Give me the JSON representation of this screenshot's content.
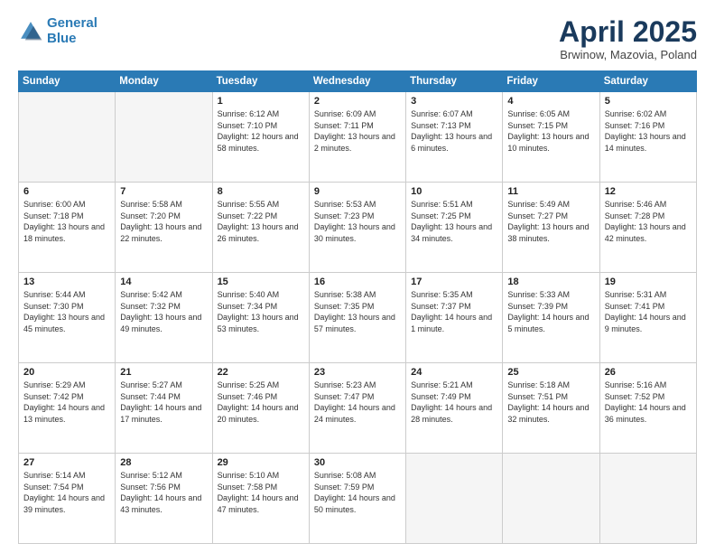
{
  "logo": {
    "line1": "General",
    "line2": "Blue"
  },
  "title": "April 2025",
  "subtitle": "Brwinow, Mazovia, Poland",
  "weekdays": [
    "Sunday",
    "Monday",
    "Tuesday",
    "Wednesday",
    "Thursday",
    "Friday",
    "Saturday"
  ],
  "weeks": [
    [
      {
        "day": "",
        "empty": true
      },
      {
        "day": "",
        "empty": true
      },
      {
        "day": "1",
        "sunrise": "Sunrise: 6:12 AM",
        "sunset": "Sunset: 7:10 PM",
        "daylight": "Daylight: 12 hours and 58 minutes."
      },
      {
        "day": "2",
        "sunrise": "Sunrise: 6:09 AM",
        "sunset": "Sunset: 7:11 PM",
        "daylight": "Daylight: 13 hours and 2 minutes."
      },
      {
        "day": "3",
        "sunrise": "Sunrise: 6:07 AM",
        "sunset": "Sunset: 7:13 PM",
        "daylight": "Daylight: 13 hours and 6 minutes."
      },
      {
        "day": "4",
        "sunrise": "Sunrise: 6:05 AM",
        "sunset": "Sunset: 7:15 PM",
        "daylight": "Daylight: 13 hours and 10 minutes."
      },
      {
        "day": "5",
        "sunrise": "Sunrise: 6:02 AM",
        "sunset": "Sunset: 7:16 PM",
        "daylight": "Daylight: 13 hours and 14 minutes."
      }
    ],
    [
      {
        "day": "6",
        "sunrise": "Sunrise: 6:00 AM",
        "sunset": "Sunset: 7:18 PM",
        "daylight": "Daylight: 13 hours and 18 minutes."
      },
      {
        "day": "7",
        "sunrise": "Sunrise: 5:58 AM",
        "sunset": "Sunset: 7:20 PM",
        "daylight": "Daylight: 13 hours and 22 minutes."
      },
      {
        "day": "8",
        "sunrise": "Sunrise: 5:55 AM",
        "sunset": "Sunset: 7:22 PM",
        "daylight": "Daylight: 13 hours and 26 minutes."
      },
      {
        "day": "9",
        "sunrise": "Sunrise: 5:53 AM",
        "sunset": "Sunset: 7:23 PM",
        "daylight": "Daylight: 13 hours and 30 minutes."
      },
      {
        "day": "10",
        "sunrise": "Sunrise: 5:51 AM",
        "sunset": "Sunset: 7:25 PM",
        "daylight": "Daylight: 13 hours and 34 minutes."
      },
      {
        "day": "11",
        "sunrise": "Sunrise: 5:49 AM",
        "sunset": "Sunset: 7:27 PM",
        "daylight": "Daylight: 13 hours and 38 minutes."
      },
      {
        "day": "12",
        "sunrise": "Sunrise: 5:46 AM",
        "sunset": "Sunset: 7:28 PM",
        "daylight": "Daylight: 13 hours and 42 minutes."
      }
    ],
    [
      {
        "day": "13",
        "sunrise": "Sunrise: 5:44 AM",
        "sunset": "Sunset: 7:30 PM",
        "daylight": "Daylight: 13 hours and 45 minutes."
      },
      {
        "day": "14",
        "sunrise": "Sunrise: 5:42 AM",
        "sunset": "Sunset: 7:32 PM",
        "daylight": "Daylight: 13 hours and 49 minutes."
      },
      {
        "day": "15",
        "sunrise": "Sunrise: 5:40 AM",
        "sunset": "Sunset: 7:34 PM",
        "daylight": "Daylight: 13 hours and 53 minutes."
      },
      {
        "day": "16",
        "sunrise": "Sunrise: 5:38 AM",
        "sunset": "Sunset: 7:35 PM",
        "daylight": "Daylight: 13 hours and 57 minutes."
      },
      {
        "day": "17",
        "sunrise": "Sunrise: 5:35 AM",
        "sunset": "Sunset: 7:37 PM",
        "daylight": "Daylight: 14 hours and 1 minute."
      },
      {
        "day": "18",
        "sunrise": "Sunrise: 5:33 AM",
        "sunset": "Sunset: 7:39 PM",
        "daylight": "Daylight: 14 hours and 5 minutes."
      },
      {
        "day": "19",
        "sunrise": "Sunrise: 5:31 AM",
        "sunset": "Sunset: 7:41 PM",
        "daylight": "Daylight: 14 hours and 9 minutes."
      }
    ],
    [
      {
        "day": "20",
        "sunrise": "Sunrise: 5:29 AM",
        "sunset": "Sunset: 7:42 PM",
        "daylight": "Daylight: 14 hours and 13 minutes."
      },
      {
        "day": "21",
        "sunrise": "Sunrise: 5:27 AM",
        "sunset": "Sunset: 7:44 PM",
        "daylight": "Daylight: 14 hours and 17 minutes."
      },
      {
        "day": "22",
        "sunrise": "Sunrise: 5:25 AM",
        "sunset": "Sunset: 7:46 PM",
        "daylight": "Daylight: 14 hours and 20 minutes."
      },
      {
        "day": "23",
        "sunrise": "Sunrise: 5:23 AM",
        "sunset": "Sunset: 7:47 PM",
        "daylight": "Daylight: 14 hours and 24 minutes."
      },
      {
        "day": "24",
        "sunrise": "Sunrise: 5:21 AM",
        "sunset": "Sunset: 7:49 PM",
        "daylight": "Daylight: 14 hours and 28 minutes."
      },
      {
        "day": "25",
        "sunrise": "Sunrise: 5:18 AM",
        "sunset": "Sunset: 7:51 PM",
        "daylight": "Daylight: 14 hours and 32 minutes."
      },
      {
        "day": "26",
        "sunrise": "Sunrise: 5:16 AM",
        "sunset": "Sunset: 7:52 PM",
        "daylight": "Daylight: 14 hours and 36 minutes."
      }
    ],
    [
      {
        "day": "27",
        "sunrise": "Sunrise: 5:14 AM",
        "sunset": "Sunset: 7:54 PM",
        "daylight": "Daylight: 14 hours and 39 minutes."
      },
      {
        "day": "28",
        "sunrise": "Sunrise: 5:12 AM",
        "sunset": "Sunset: 7:56 PM",
        "daylight": "Daylight: 14 hours and 43 minutes."
      },
      {
        "day": "29",
        "sunrise": "Sunrise: 5:10 AM",
        "sunset": "Sunset: 7:58 PM",
        "daylight": "Daylight: 14 hours and 47 minutes."
      },
      {
        "day": "30",
        "sunrise": "Sunrise: 5:08 AM",
        "sunset": "Sunset: 7:59 PM",
        "daylight": "Daylight: 14 hours and 50 minutes."
      },
      {
        "day": "",
        "empty": true
      },
      {
        "day": "",
        "empty": true
      },
      {
        "day": "",
        "empty": true
      }
    ]
  ]
}
